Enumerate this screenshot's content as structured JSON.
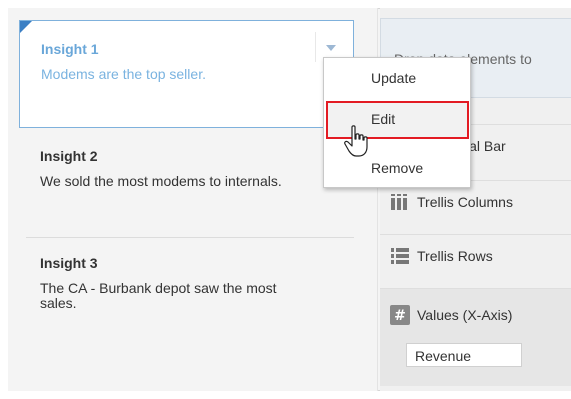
{
  "insights": [
    {
      "title": "Insight 1",
      "text": "Modems are the top seller."
    },
    {
      "title": "Insight 2",
      "text": "We sold the most modems to internals."
    },
    {
      "title": "Insight 3",
      "text": "The CA - Burbank depot saw the most sales."
    }
  ],
  "context_menu": {
    "items": [
      "Update",
      "Edit",
      "Remove"
    ],
    "highlighted": "Edit",
    "highlight_color": "#e31b23"
  },
  "right_panel": {
    "drop_hint": "Drop data elements to",
    "rows": [
      {
        "label": "Horizontal Bar",
        "icon": "horizontal-bar-icon"
      },
      {
        "label": "Trellis Columns",
        "icon": "trellis-columns-icon"
      },
      {
        "label": "Trellis Rows",
        "icon": "trellis-rows-icon"
      },
      {
        "label": "Values (X-Axis)",
        "icon": "values-axis-icon"
      }
    ],
    "values_item": "Revenue"
  },
  "colors": {
    "accent": "#3b7fc4",
    "selected_text": "#6aa7d9"
  }
}
